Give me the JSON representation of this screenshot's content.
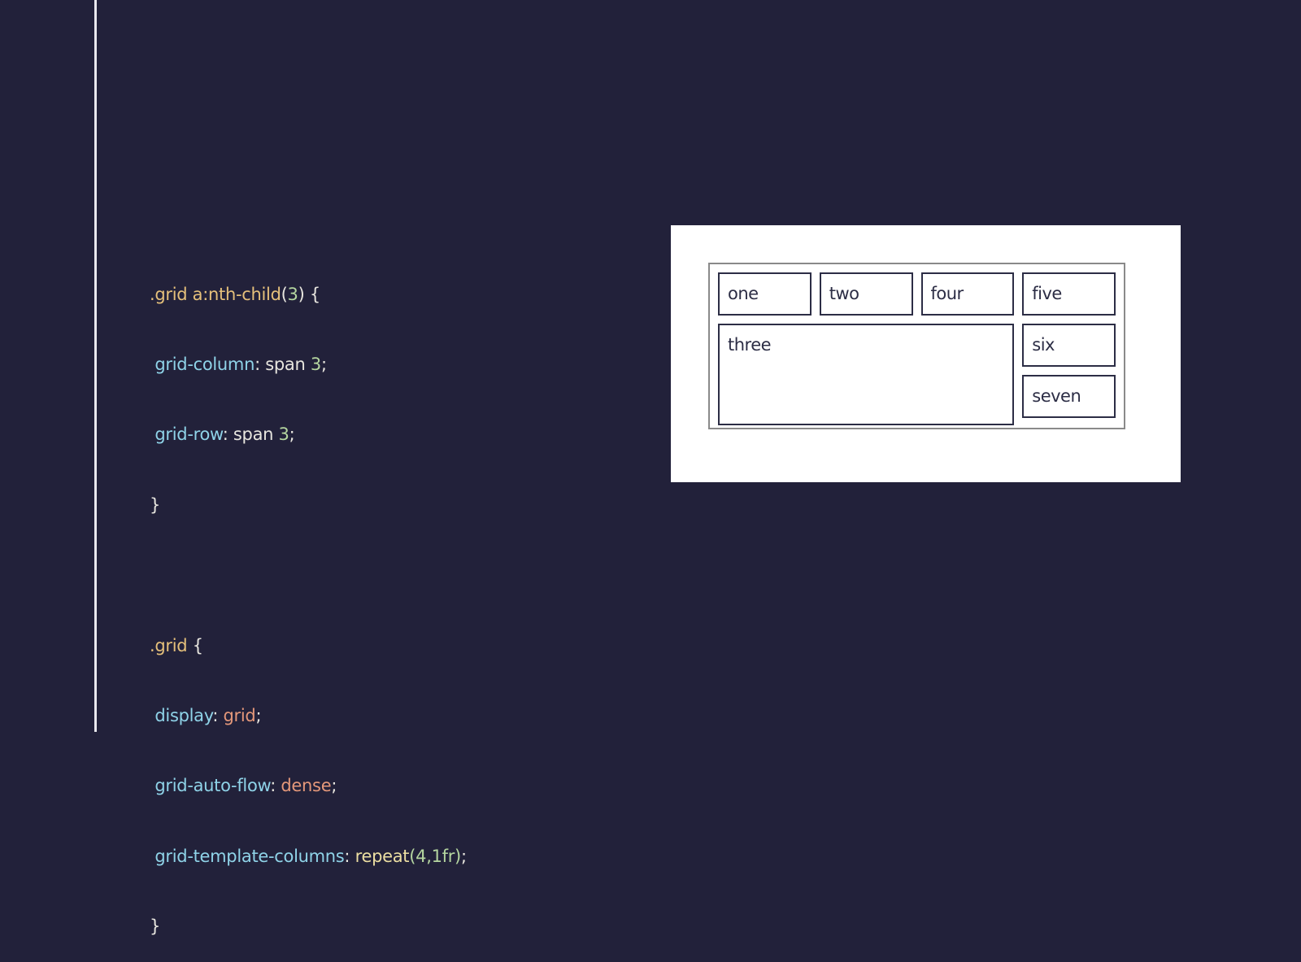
{
  "code": {
    "block1": {
      "selector": ".grid a:nth-child",
      "arg_open": "(",
      "arg": "3",
      "arg_close": ")",
      "brace_open": " {",
      "decl1_prop": "grid-column",
      "decl1_value": "span ",
      "decl1_num": "3",
      "decl2_prop": "grid-row",
      "decl2_value": "span ",
      "decl2_num": "3",
      "brace_close": "}"
    },
    "block2": {
      "selector": ".grid",
      "brace_open": " {",
      "decl1_prop": "display",
      "decl1_value": "grid",
      "decl2_prop": "grid-auto-flow",
      "decl2_value": "dense",
      "decl3_prop": "grid-template-columns",
      "decl3_fn": "repeat",
      "decl3_args": "(4,1fr)",
      "brace_close": "}"
    },
    "colon": ": ",
    "semicolon": ";"
  },
  "demo": {
    "items": [
      {
        "label": "one"
      },
      {
        "label": "two"
      },
      {
        "label": "three"
      },
      {
        "label": "four"
      },
      {
        "label": "five"
      },
      {
        "label": "six"
      },
      {
        "label": "seven"
      }
    ]
  }
}
